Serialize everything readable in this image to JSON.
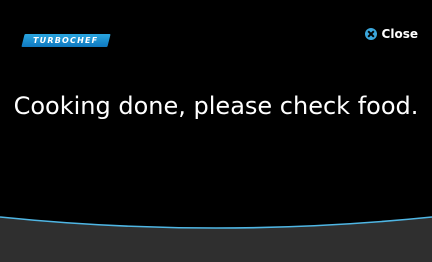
{
  "header": {
    "logo_text": "TURBOCHEF",
    "close_label": "Close",
    "close_icon": "close-circle-icon"
  },
  "main": {
    "message": "Cooking done, please check food."
  },
  "colors": {
    "background": "#000000",
    "accent": "#3ba7dc",
    "bottom_panel": "#2f2f2f",
    "wave_line": "#4fb6e4"
  }
}
